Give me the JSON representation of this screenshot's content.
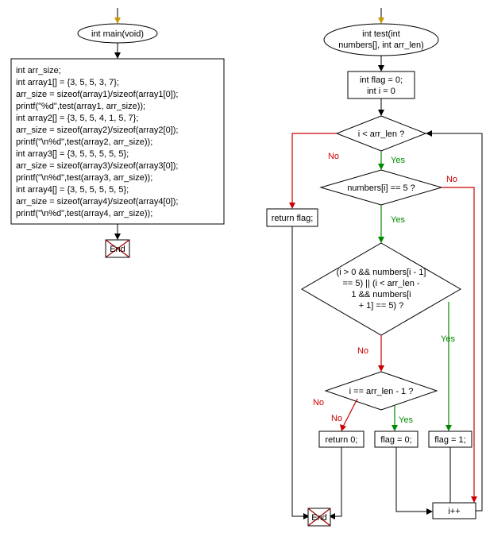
{
  "left": {
    "entry": "int main(void)",
    "code": [
      "int arr_size;",
      "int array1[] = {3, 5, 5, 3, 7};",
      "arr_size = sizeof(array1)/sizeof(array1[0]);",
      "printf(\"%d\",test(array1, arr_size));",
      "int array2[] = {3, 5, 5, 4, 1, 5, 7};",
      "arr_size = sizeof(array2)/sizeof(array2[0]);",
      "printf(\"\\n%d\",test(array2, arr_size));",
      "int array3[] = {3, 5, 5, 5, 5, 5};",
      "arr_size = sizeof(array3)/sizeof(array3[0]);",
      "printf(\"\\n%d\",test(array3, arr_size));",
      "int array4[] = {3, 5, 5, 5, 5, 5};",
      "arr_size = sizeof(array4)/sizeof(array4[0]);",
      "printf(\"\\n%d\",test(array4, arr_size));"
    ],
    "end": "End"
  },
  "right": {
    "entry_l1": "int test(int",
    "entry_l2": "numbers[], int arr_len)",
    "init_l1": "int flag = 0;",
    "init_l2": "int i = 0",
    "cond_loop": "i < arr_len ?",
    "cond_eq5": "numbers[i] == 5 ?",
    "cond_adj_l1": "(i > 0 && numbers[i - 1]",
    "cond_adj_l2": "== 5) || (i < arr_len -",
    "cond_adj_l3": "1 && numbers[i",
    "cond_adj_l4": "+ 1] == 5) ?",
    "cond_last": "i == arr_len - 1 ?",
    "stmt_flag1": "flag = 1;",
    "stmt_flag0": "flag = 0;",
    "stmt_ret0": "return 0;",
    "stmt_retflag": "return flag;",
    "stmt_incr": "i++",
    "end": "End",
    "yes": "Yes",
    "no": "No"
  },
  "chart_data": {
    "type": "diagram",
    "subtype": "flowchart",
    "functions": [
      {
        "name": "main",
        "signature": "int main(void)",
        "body": [
          "int arr_size;",
          "int array1[] = {3, 5, 5, 3, 7};",
          "arr_size = sizeof(array1)/sizeof(array1[0]);",
          "printf(\"%d\",test(array1, arr_size));",
          "int array2[] = {3, 5, 5, 4, 1, 5, 7};",
          "arr_size = sizeof(array2)/sizeof(array2[0]);",
          "printf(\"\\n%d\",test(array2, arr_size));",
          "int array3[] = {3, 5, 5, 5, 5, 5};",
          "arr_size = sizeof(array3)/sizeof(array3[0]);",
          "printf(\"\\n%d\",test(array3, arr_size));",
          "int array4[] = {3, 5, 5, 5, 5, 5};",
          "arr_size = sizeof(array4)/sizeof(array4[0]);",
          "printf(\"\\n%d\",test(array4, arr_size));"
        ],
        "nodes": [
          {
            "id": "m_start",
            "type": "terminator",
            "label": "int main(void)"
          },
          {
            "id": "m_body",
            "type": "process",
            "label": "<body block>"
          },
          {
            "id": "m_end",
            "type": "end",
            "label": "End"
          }
        ],
        "edges": [
          {
            "from": "m_start",
            "to": "m_body"
          },
          {
            "from": "m_body",
            "to": "m_end"
          }
        ]
      },
      {
        "name": "test",
        "signature": "int test(int numbers[], int arr_len)",
        "nodes": [
          {
            "id": "t_start",
            "type": "terminator",
            "label": "int test(int numbers[], int arr_len)"
          },
          {
            "id": "t_init",
            "type": "process",
            "label": "int flag = 0; int i = 0"
          },
          {
            "id": "t_loop",
            "type": "decision",
            "label": "i < arr_len ?"
          },
          {
            "id": "t_retflag",
            "type": "process",
            "label": "return flag;"
          },
          {
            "id": "t_eq5",
            "type": "decision",
            "label": "numbers[i] == 5 ?"
          },
          {
            "id": "t_adj",
            "type": "decision",
            "label": "(i > 0 && numbers[i - 1] == 5) || (i < arr_len - 1 && numbers[i + 1] == 5) ?"
          },
          {
            "id": "t_flag1",
            "type": "process",
            "label": "flag = 1;"
          },
          {
            "id": "t_last",
            "type": "decision",
            "label": "i == arr_len - 1 ?"
          },
          {
            "id": "t_flag0",
            "type": "process",
            "label": "flag = 0;"
          },
          {
            "id": "t_ret0",
            "type": "process",
            "label": "return 0;"
          },
          {
            "id": "t_incr",
            "type": "process",
            "label": "i++"
          },
          {
            "id": "t_end",
            "type": "end",
            "label": "End"
          }
        ],
        "edges": [
          {
            "from": "t_start",
            "to": "t_init"
          },
          {
            "from": "t_init",
            "to": "t_loop"
          },
          {
            "from": "t_loop",
            "to": "t_eq5",
            "label": "Yes"
          },
          {
            "from": "t_loop",
            "to": "t_retflag",
            "label": "No"
          },
          {
            "from": "t_retflag",
            "to": "t_end"
          },
          {
            "from": "t_eq5",
            "to": "t_adj",
            "label": "Yes"
          },
          {
            "from": "t_eq5",
            "to": "t_incr",
            "label": "No"
          },
          {
            "from": "t_adj",
            "to": "t_flag1",
            "label": "Yes"
          },
          {
            "from": "t_adj",
            "to": "t_last",
            "label": "No"
          },
          {
            "from": "t_flag1",
            "to": "t_incr"
          },
          {
            "from": "t_last",
            "to": "t_flag0",
            "label": "Yes"
          },
          {
            "from": "t_last",
            "to": "t_ret0",
            "label": "No"
          },
          {
            "from": "t_flag0",
            "to": "t_incr"
          },
          {
            "from": "t_ret0",
            "to": "t_end"
          },
          {
            "from": "t_incr",
            "to": "t_loop"
          }
        ]
      }
    ]
  }
}
